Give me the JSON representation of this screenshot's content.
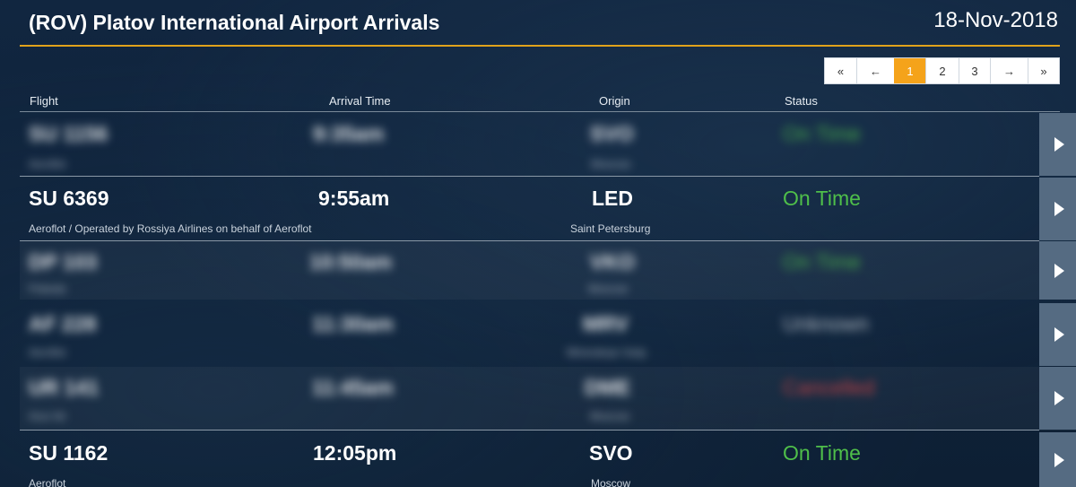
{
  "header": {
    "title": "(ROV) Platov International Airport Arrivals",
    "date": "18-Nov-2018"
  },
  "pagination": {
    "items": [
      "«",
      "←",
      "1",
      "2",
      "3",
      "→",
      "»"
    ],
    "active": "1"
  },
  "columns": {
    "flight": "Flight",
    "arrival": "Arrival Time",
    "origin": "Origin",
    "status": "Status"
  },
  "flights": [
    {
      "flight": "SU 1156",
      "airline": "Aeroflot",
      "time": "9:35am",
      "code": "SVO",
      "city": "Moscow",
      "status": "On Time",
      "status_color": "#4fbf4a",
      "blurred": true
    },
    {
      "flight": "SU 6369",
      "airline": "Aeroflot / Operated by Rossiya Airlines on behalf of Aeroflot",
      "time": "9:55am",
      "code": "LED",
      "city": "Saint Petersburg",
      "status": "On Time",
      "status_color": "#4fbf4a",
      "blurred": false
    },
    {
      "flight": "DP 103",
      "airline": "Pobeda",
      "time": "10:50am",
      "code": "VKO",
      "city": "Moscow",
      "status": "On Time",
      "status_color": "#4fbf4a",
      "blurred": true
    },
    {
      "flight": "AF 228",
      "airline": "Aeroflot",
      "time": "11:30am",
      "code": "MRV",
      "city": "Mineralnye Vody",
      "status": "Unknown",
      "status_color": "#c8ced6",
      "blurred": true
    },
    {
      "flight": "UR 141",
      "airline": "Azur Air",
      "time": "11:45am",
      "code": "DME",
      "city": "Moscow",
      "status": "Cancelled",
      "status_color": "#e04545",
      "blurred": true
    },
    {
      "flight": "SU 1162",
      "airline": "Aeroflot",
      "time": "12:05pm",
      "code": "SVO",
      "city": "Moscow",
      "status": "On Time",
      "status_color": "#4fbf4a",
      "blurred": false
    }
  ]
}
